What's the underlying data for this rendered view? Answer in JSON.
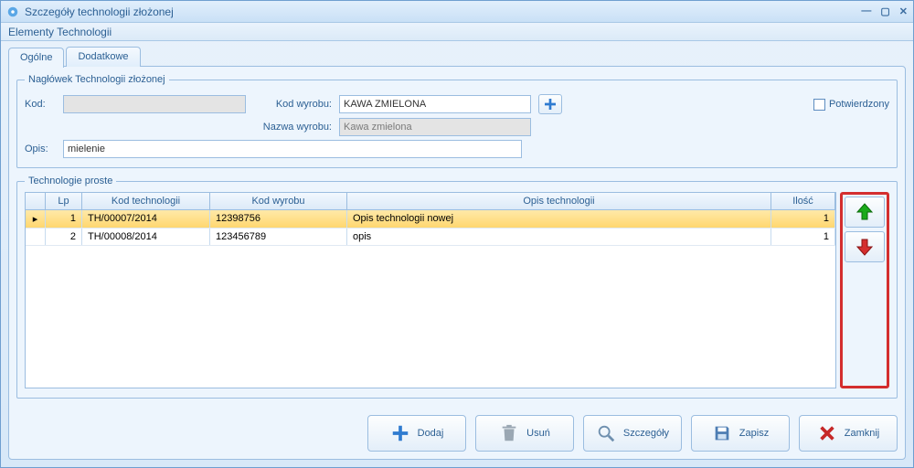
{
  "window": {
    "title": "Szczegóły technologii złożonej"
  },
  "section": {
    "title": "Elementy Technologii"
  },
  "tabs": {
    "general": "Ogólne",
    "additional": "Dodatkowe"
  },
  "header": {
    "legend": "Nagłówek Technologii złożonej",
    "kod_label": "Kod:",
    "kod_value": "",
    "kod_wyrobu_label": "Kod wyrobu:",
    "kod_wyrobu_value": "KAWA ZMIELONA",
    "nazwa_wyrobu_label": "Nazwa wyrobu:",
    "nazwa_wyrobu_value": "Kawa zmielona",
    "opis_label": "Opis:",
    "opis_value": "mielenie",
    "potwierdzony_label": "Potwierdzony"
  },
  "grid": {
    "legend": "Technologie proste",
    "cols": {
      "lp": "Lp",
      "kodtech": "Kod technologii",
      "kodwyr": "Kod wyrobu",
      "opis": "Opis technologii",
      "ilosc": "Ilość"
    },
    "rows": [
      {
        "marker": "▸",
        "lp": "1",
        "kodtech": "TH/00007/2014",
        "kodwyr": "12398756",
        "opis": "Opis technologii nowej",
        "ilosc": "1",
        "sel": true
      },
      {
        "marker": "",
        "lp": "2",
        "kodtech": "TH/00008/2014",
        "kodwyr": "123456789",
        "opis": "opis",
        "ilosc": "1",
        "sel": false
      }
    ]
  },
  "buttons": {
    "dodaj": "Dodaj",
    "usun": "Usuń",
    "szczegoly": "Szczegóły",
    "zapisz": "Zapisz",
    "zamknij": "Zamknij"
  }
}
